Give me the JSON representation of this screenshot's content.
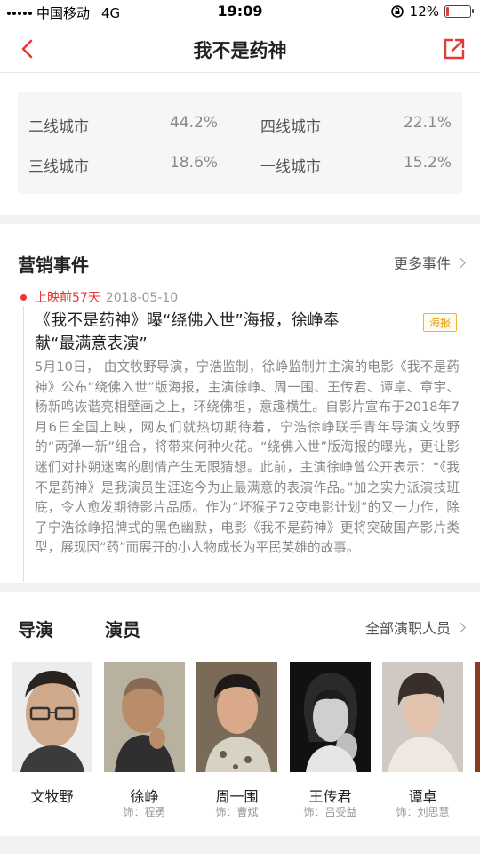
{
  "status": {
    "carrier": "中国移动",
    "network": "4G",
    "time": "19:09",
    "battery_text": "12%",
    "battery_level": 0.12,
    "battery_color": "#e53935"
  },
  "nav": {
    "back_icon": "chevron-left-icon",
    "title": "我不是药神",
    "share_icon": "share-icon",
    "accent": "#e53935"
  },
  "city_stats": [
    {
      "name": "二线城市",
      "value": "44.2%"
    },
    {
      "name": "四线城市",
      "value": "22.1%"
    },
    {
      "name": "三线城市",
      "value": "18.6%"
    },
    {
      "name": "一线城市",
      "value": "15.2%"
    }
  ],
  "marketing": {
    "title": "营销事件",
    "more": "更多事件",
    "event": {
      "days": "上映前57天",
      "date": "2018-05-10",
      "title": "《我不是药神》曝“绕佛入世”海报，徐峥奉献“最满意表演”",
      "tag": "海报",
      "body": "5月10日， 由文牧野导演，宁浩监制，徐峥监制并主演的电影《我不是药神》公布“绕佛入世”版海报，主演徐峥、周一围、王传君、谭卓、章宇、杨新鸣诙谐亮相壁画之上，环绕佛祖，意趣横生。自影片宣布于2018年7月6日全国上映，网友们就热切期待着，宁浩徐峥联手青年导演文牧野的“两弹一新”组合，将带来何种火花。“绕佛入世”版海报的曝光，更让影迷们对扑朔迷离的剧情产生无限猜想。此前，主演徐峥曾公开表示：“《我不是药神》是我演员生涯迄今为止最满意的表演作品。”加之实力派演技班底，令人愈发期待影片品质。作为“坏猴子72变电影计划”的又一力作，除了宁浩徐峥招牌式的黑色幽默，电影《我不是药神》更将突破国产影片类型，展现因“药”而展开的小人物成长为平民英雄的故事。"
    }
  },
  "cast": {
    "director_title": "导演",
    "actors_title": "演员",
    "more": "全部演职人员",
    "people": [
      {
        "name": "文牧野",
        "role": ""
      },
      {
        "name": "徐峥",
        "role": "饰：程勇"
      },
      {
        "name": "周一围",
        "role": "饰：曹斌"
      },
      {
        "name": "王传君",
        "role": "饰：吕受益"
      },
      {
        "name": "谭卓",
        "role": "饰：刘思慧"
      }
    ]
  }
}
